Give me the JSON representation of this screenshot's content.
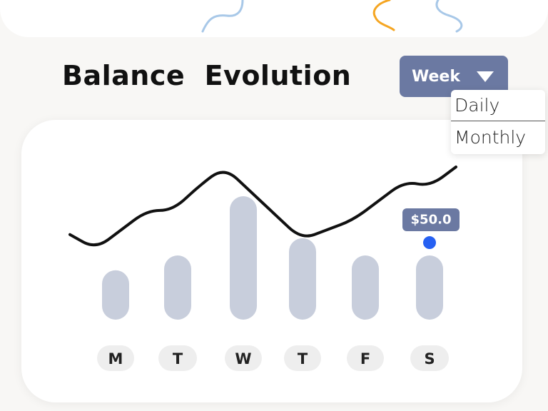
{
  "header": {
    "title": "Balance  Evolution"
  },
  "period_selector": {
    "selected": "Week",
    "options": [
      "Daily",
      "Monthly"
    ]
  },
  "tooltip": {
    "label": "$50.0"
  },
  "colors": {
    "accent": "#6b79a2",
    "bar": "#c8cedc",
    "highlight_dot": "#2660f2",
    "line": "#111111",
    "doodle_blue": "#a8c8e8",
    "doodle_orange": "#f5a623"
  },
  "chart_data": {
    "type": "bar",
    "categories": [
      "M",
      "T",
      "W",
      "T",
      "F",
      "S"
    ],
    "values": [
      20,
      26,
      50,
      33,
      26,
      26
    ],
    "highlighted_index": 5,
    "highlight_value_label": "$50.0",
    "ylim": [
      0,
      50
    ],
    "grid": false,
    "line": {
      "values": [
        33,
        30,
        34,
        38,
        38,
        43,
        47,
        42,
        37,
        32,
        34,
        36,
        40,
        44,
        43,
        47
      ]
    }
  }
}
